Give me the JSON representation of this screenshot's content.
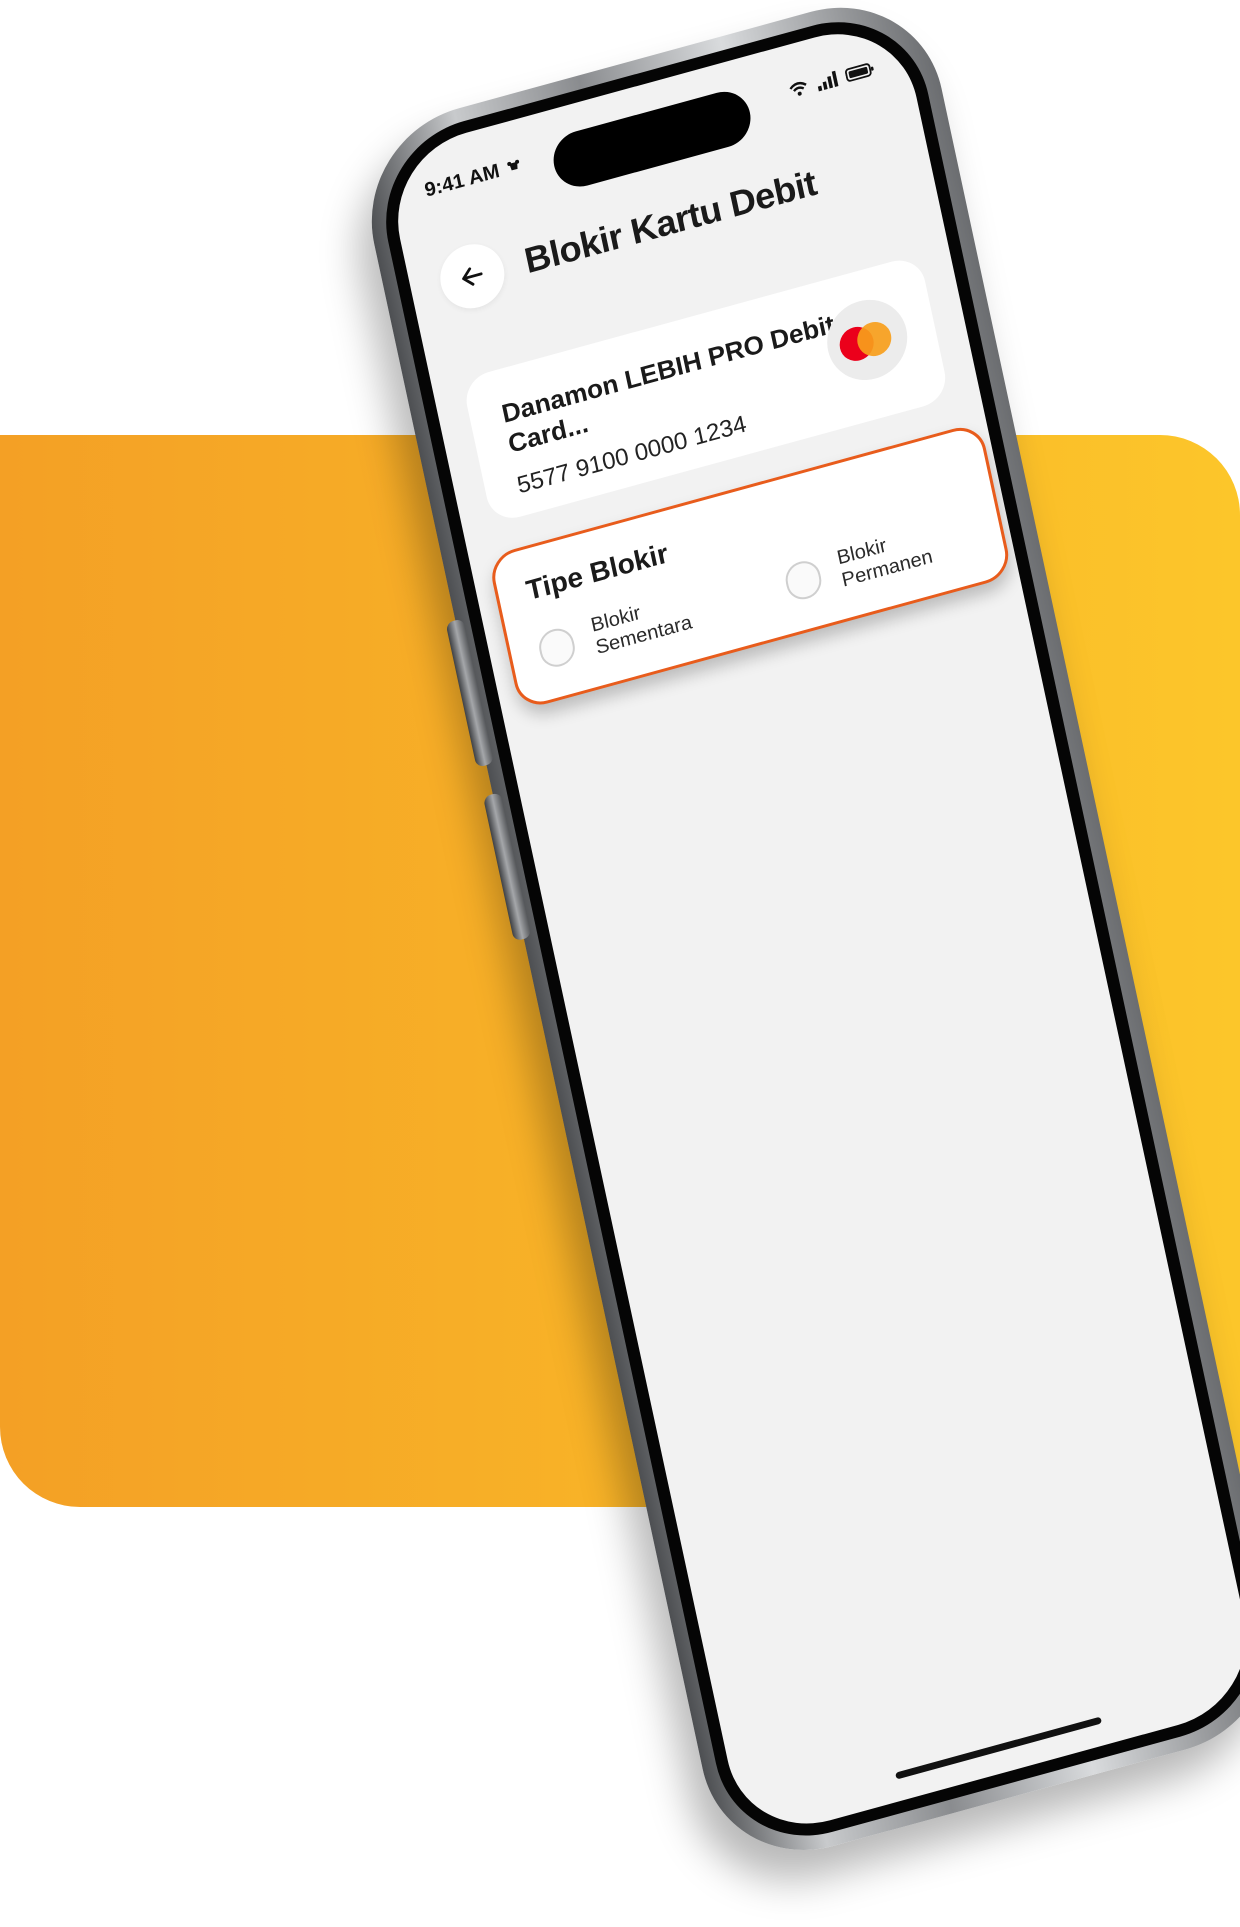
{
  "colors": {
    "backdrop_start": "#f4a025",
    "backdrop_end": "#fcc62a",
    "accent_border": "#e85c1c",
    "screen_bg": "#f2f2f2"
  },
  "status_bar": {
    "time": "9:41 AM",
    "left_icon": "notification-icon",
    "right_icons": [
      "wifi-icon",
      "signal-icon",
      "battery-icon"
    ]
  },
  "header": {
    "back_icon": "arrow-left-icon",
    "title": "Blokir Kartu Debit"
  },
  "card": {
    "name": "Danamon LEBIH PRO Debit Card...",
    "number": "5577 9100 0000 1234",
    "brand_icon": "mastercard-icon"
  },
  "block_type": {
    "title": "Tipe Blokir",
    "options": [
      {
        "label": "Blokir Sementara",
        "selected": false
      },
      {
        "label": "Blokir Permanen",
        "selected": false
      }
    ]
  }
}
